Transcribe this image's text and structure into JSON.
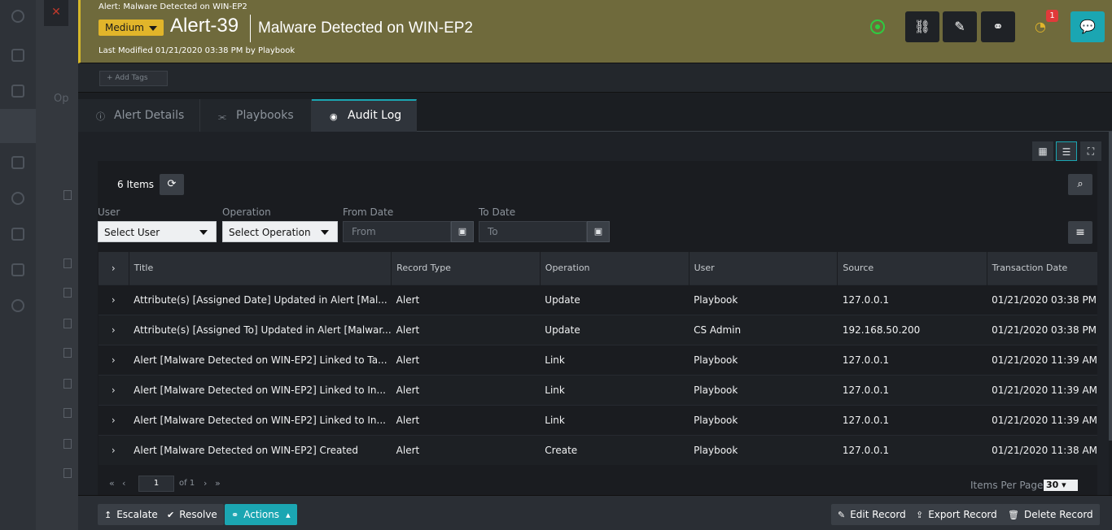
{
  "background": {
    "close_label": "✕",
    "partial_text": "Op"
  },
  "header": {
    "breadcrumb": "Alert: Malware Detected on WIN-EP2",
    "severity": "Medium",
    "alert_id": "Alert-39",
    "alert_title": "Malware Detected on WIN-EP2",
    "last_modified": "Last Modified 01/21/2020 03:38 PM by Playbook",
    "notification_count": "1",
    "status_color": "#2ecc40",
    "accent_color": "#1ba6b2",
    "severity_color": "#e1b52a",
    "buttons": [
      {
        "name": "hierarchy-icon",
        "glyph": "⛓"
      },
      {
        "name": "edit-icon",
        "glyph": "✎"
      },
      {
        "name": "link-icon",
        "glyph": "⚭"
      },
      {
        "name": "timer-icon",
        "glyph": "◔"
      },
      {
        "name": "chat-icon",
        "glyph": "💬"
      }
    ]
  },
  "tags": {
    "add_label": "+ Add Tags"
  },
  "tabs": [
    {
      "label": "Alert Details",
      "icon": "info-icon",
      "glyph": "ⓘ"
    },
    {
      "label": "Playbooks",
      "icon": "playbook-icon",
      "glyph": "⫘"
    },
    {
      "label": "Audit Log",
      "icon": "eye-icon",
      "glyph": "◉"
    }
  ],
  "active_tab": "Audit Log",
  "toolbar": {
    "view_grid": "▦",
    "view_list": "☰",
    "fullscreen": "⛶"
  },
  "audit": {
    "item_count": "6 Items",
    "refresh_glyph": "⟳",
    "search_glyph": "⌕",
    "menu_glyph": "≡",
    "filters": {
      "user_label": "User",
      "user_value": "Select User",
      "operation_label": "Operation",
      "operation_value": "Select Operation",
      "from_label": "From Date",
      "from_placeholder": "From",
      "to_label": "To Date",
      "to_placeholder": "To",
      "calendar_glyph": "▣"
    },
    "columns": [
      "Title",
      "Record Type",
      "Operation",
      "User",
      "Source",
      "Transaction Date"
    ],
    "rows": [
      {
        "title": "Attribute(s) [Assigned Date] Updated in Alert [Mal...",
        "record_type": "Alert",
        "operation": "Update",
        "user": "Playbook",
        "source": "127.0.0.1",
        "date": "01/21/2020 03:38 PM"
      },
      {
        "title": "Attribute(s) [Assigned To] Updated in Alert [Malwar...",
        "record_type": "Alert",
        "operation": "Update",
        "user": "CS Admin",
        "source": "192.168.50.200",
        "date": "01/21/2020 03:38 PM"
      },
      {
        "title": "Alert [Malware Detected on WIN-EP2] Linked to Ta...",
        "record_type": "Alert",
        "operation": "Link",
        "user": "Playbook",
        "source": "127.0.0.1",
        "date": "01/21/2020 11:39 AM"
      },
      {
        "title": "Alert [Malware Detected on WIN-EP2] Linked to In...",
        "record_type": "Alert",
        "operation": "Link",
        "user": "Playbook",
        "source": "127.0.0.1",
        "date": "01/21/2020 11:39 AM"
      },
      {
        "title": "Alert [Malware Detected on WIN-EP2] Linked to In...",
        "record_type": "Alert",
        "operation": "Link",
        "user": "Playbook",
        "source": "127.0.0.1",
        "date": "01/21/2020 11:39 AM"
      },
      {
        "title": "Alert [Malware Detected on WIN-EP2] Created",
        "record_type": "Alert",
        "operation": "Create",
        "user": "Playbook",
        "source": "127.0.0.1",
        "date": "01/21/2020 11:38 AM"
      }
    ],
    "pagination": {
      "page": "1",
      "of_label": "of 1",
      "items_per_page_label": "Items Per Page",
      "items_per_page": "30"
    }
  },
  "footer": {
    "escalate": "Escalate",
    "resolve": "Resolve",
    "actions": "Actions",
    "edit_record": "Edit Record",
    "export_record": "Export Record",
    "delete_record": "Delete Record"
  }
}
